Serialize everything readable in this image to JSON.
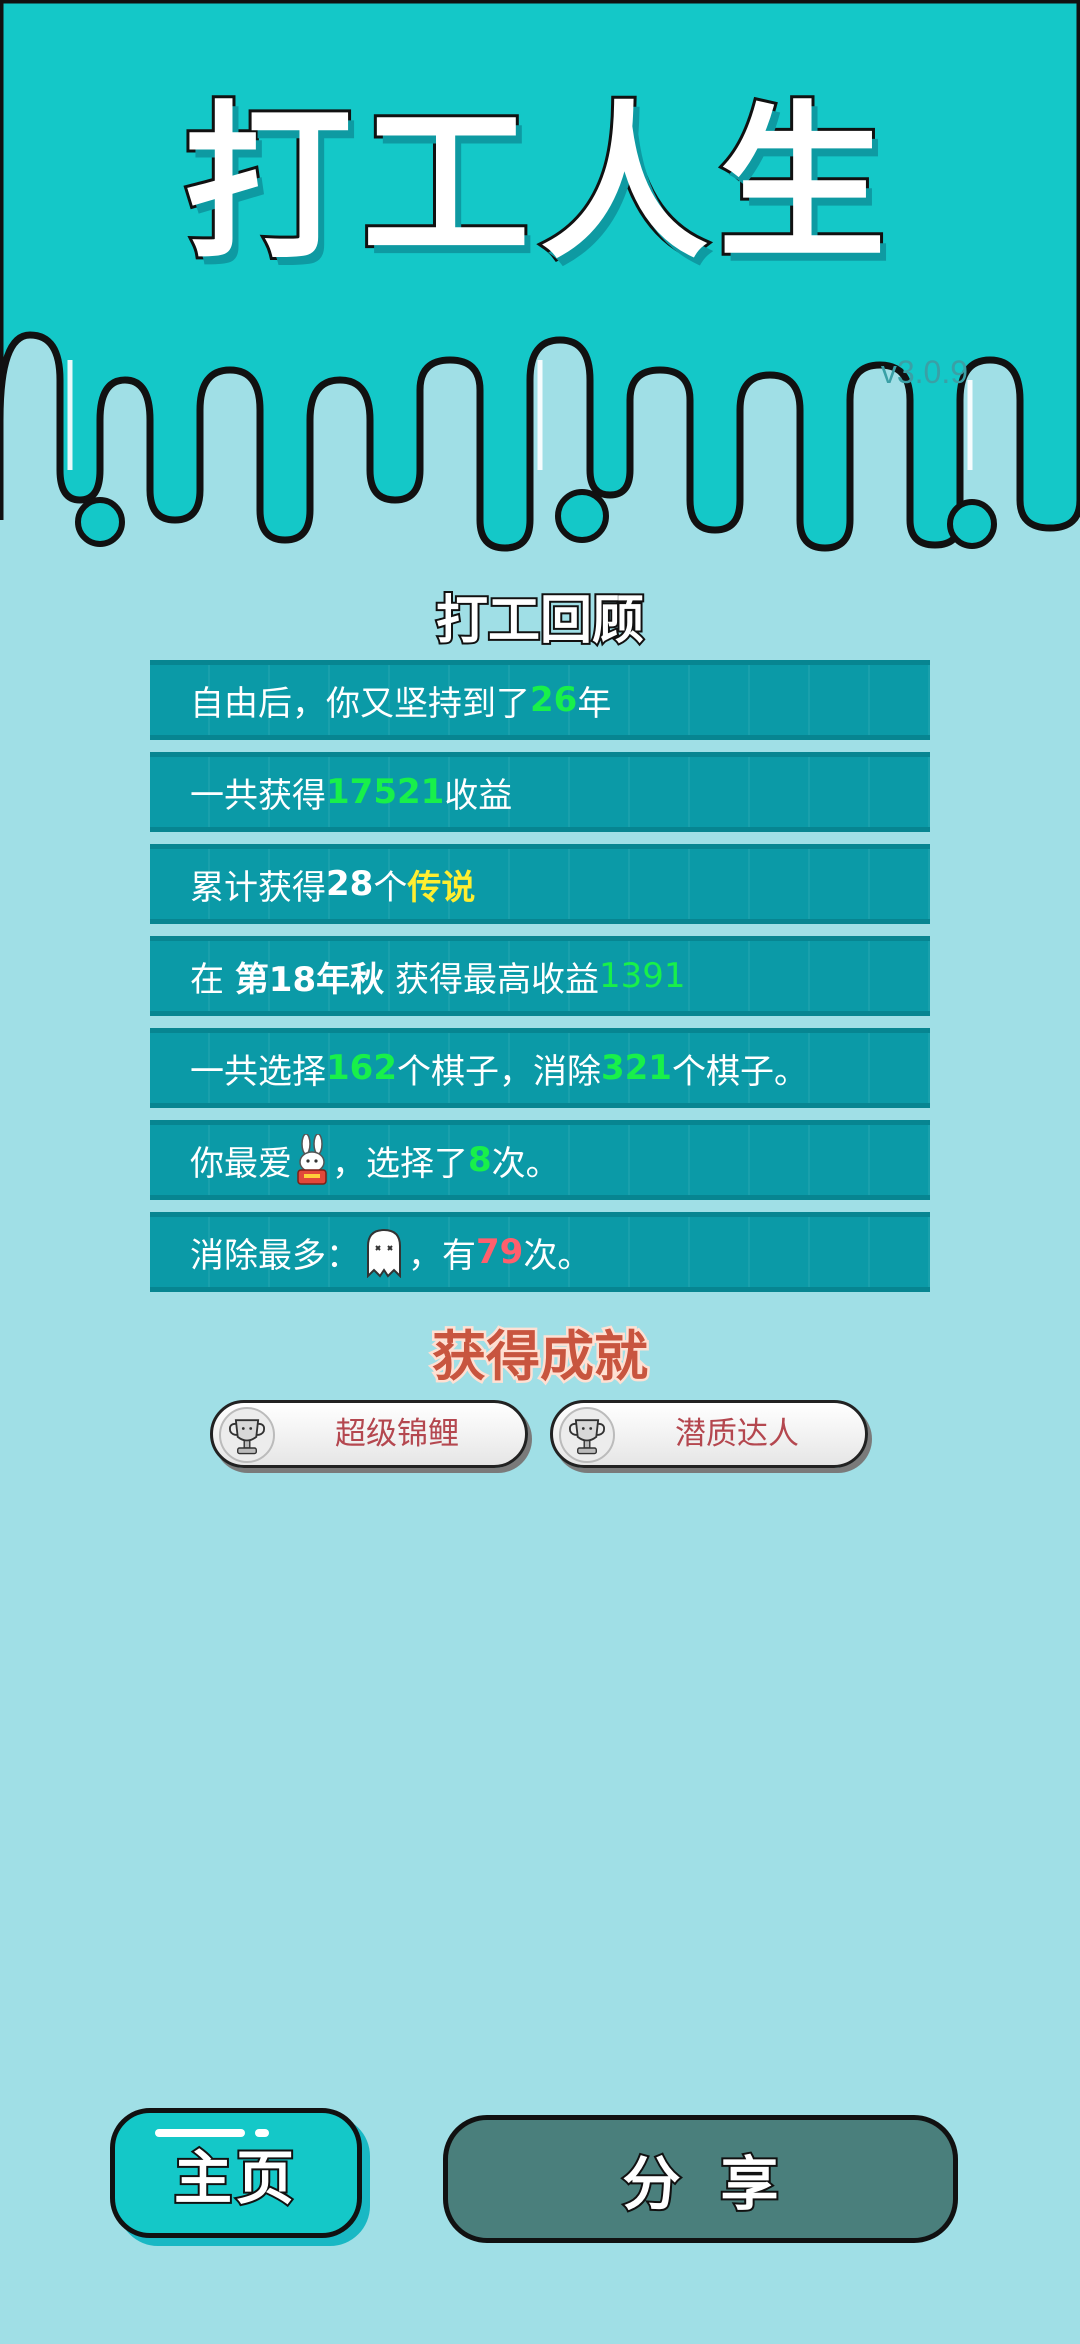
{
  "header": {
    "game_title": "打工人生",
    "version": "v3.0.9"
  },
  "colors": {
    "background": "#a0dfe6",
    "header_teal": "#14c8c8",
    "row_teal": "#0b9aa7",
    "highlight_green": "#18f04a",
    "highlight_yellow": "#ffee30",
    "highlight_red": "#ff5f6d",
    "share_button": "#4a7f7c"
  },
  "review": {
    "title": "打工回顾",
    "rows": [
      {
        "pre": "自由后，你又坚持到了",
        "value": "26",
        "post": "年"
      },
      {
        "pre": "一共获得",
        "value": "17521",
        "post": "收益"
      },
      {
        "pre": "累计获得",
        "count": "28",
        "mid": "个",
        "keyword": "传说"
      },
      {
        "pre": "在 ",
        "season": "第18年秋",
        "mid": " 获得最高收益",
        "value": "1391"
      },
      {
        "pre": "一共选择",
        "chosen": "162",
        "mid": "个棋子，消除",
        "eliminated": "321",
        "post": "个棋子。"
      },
      {
        "pre": "你最爱",
        "icon": "rabbit-icon",
        "mid": "，选择了",
        "value": "8",
        "post": "次。"
      },
      {
        "pre": "消除最多：",
        "icon": "ghost-icon",
        "mid": "，有",
        "value": "79",
        "post": "次。"
      }
    ]
  },
  "achievements": {
    "title": "获得成就",
    "badges": [
      {
        "label": "超级锦鲤",
        "icon": "trophy-icon"
      },
      {
        "label": "潜质达人",
        "icon": "trophy-icon"
      }
    ]
  },
  "buttons": {
    "home_label": "主页",
    "share_label": "分享"
  }
}
